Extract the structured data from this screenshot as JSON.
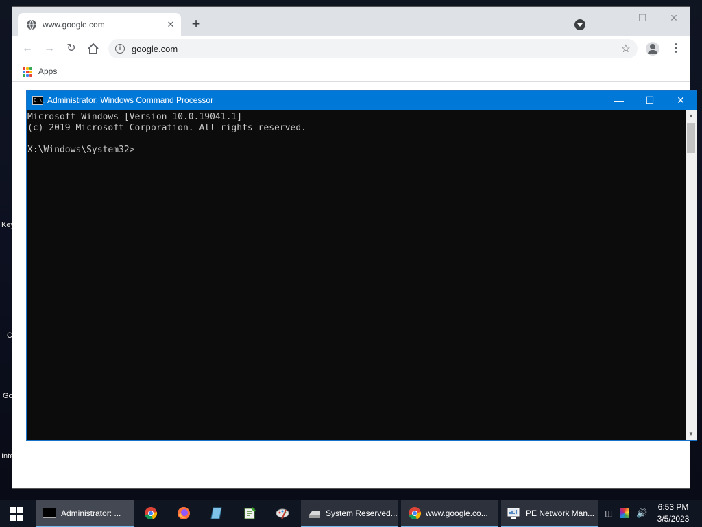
{
  "desktop": {
    "labels": [
      "Key",
      "C",
      "Go",
      "Inte"
    ]
  },
  "chrome": {
    "tab_title": "www.google.com",
    "tab_close": "✕",
    "new_tab": "+",
    "url": "google.com",
    "bookmarks_apps": "Apps",
    "controls": {
      "minimize": "—",
      "maximize": "☐",
      "close": "✕"
    }
  },
  "cmd": {
    "title": "Administrator: Windows Command Processor",
    "icon_text": "C:\\_",
    "lines": [
      "Microsoft Windows [Version 10.0.19041.1]",
      "(c) 2019 Microsoft Corporation. All rights reserved.",
      "",
      "X:\\Windows\\System32>"
    ],
    "controls": {
      "minimize": "—",
      "maximize": "☐",
      "close": "✕"
    }
  },
  "taskbar": {
    "items": [
      {
        "label": "Administrator: ...",
        "icon": "cmd-icon",
        "active": true
      },
      {
        "label": "",
        "icon": "chrome-icon"
      },
      {
        "label": "",
        "icon": "firefox-icon"
      },
      {
        "label": "",
        "icon": "notepad-icon"
      },
      {
        "label": "",
        "icon": "editor-icon"
      },
      {
        "label": "",
        "icon": "paint-icon"
      },
      {
        "label": "System Reserved...",
        "icon": "drive-icon"
      },
      {
        "label": "www.google.co...",
        "icon": "chrome-icon"
      },
      {
        "label": "PE Network Man...",
        "icon": "network-manager-icon"
      }
    ],
    "clock_time": "6:53 PM",
    "clock_date": "3/5/2023"
  },
  "colors": {
    "cmd_titlebar": "#0078d7",
    "taskbar": "#101522",
    "chrome_tabstrip": "#dee1e6"
  }
}
